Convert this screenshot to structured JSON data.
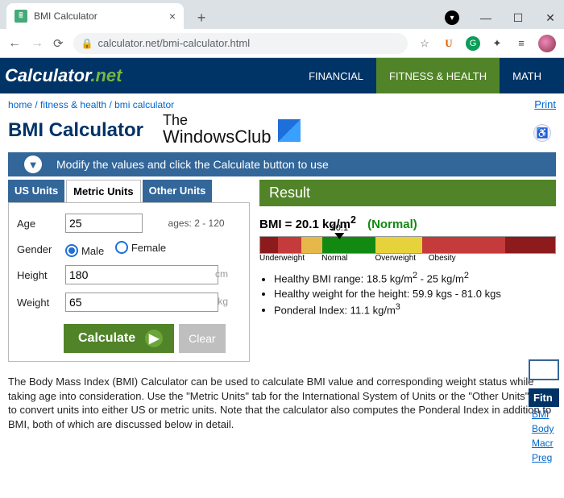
{
  "browser": {
    "tab_title": "BMI Calculator",
    "url_display": "calculator.net/bmi-calculator.html"
  },
  "site": {
    "brand1": "Calculator",
    "brand2": ".net",
    "nav": {
      "financial": "FINANCIAL",
      "fitness": "FITNESS & HEALTH",
      "math": "MATH"
    }
  },
  "breadcrumb": {
    "home": "home",
    "sep": " / ",
    "lvl1": "fitness & health",
    "lvl2": "bmi calculator"
  },
  "print": "Print",
  "page_title": "BMI Calculator",
  "overlay": {
    "line1": "The",
    "line2": "WindowsClub"
  },
  "modify_bar": "Modify the values and click the Calculate button to use",
  "unit_tabs": {
    "us": "US Units",
    "metric": "Metric Units",
    "other": "Other Units"
  },
  "form": {
    "age_label": "Age",
    "age_value": "25",
    "age_hint": "ages: 2 - 120",
    "gender_label": "Gender",
    "male": "Male",
    "female": "Female",
    "height_label": "Height",
    "height_value": "180",
    "height_unit": "cm",
    "weight_label": "Weight",
    "weight_value": "65",
    "weight_unit": "kg",
    "calculate": "Calculate",
    "clear": "Clear"
  },
  "result": {
    "heading": "Result",
    "bmi_prefix": "BMI = ",
    "bmi_value": "20.1 kg/m",
    "bmi_exp": "2",
    "category": "(Normal)",
    "pointer": "20.1",
    "labels": {
      "uw": "Underweight",
      "nm": "Normal",
      "ow": "Overweight",
      "ob": "Obesity"
    },
    "bullets": {
      "b1a": "Healthy BMI range: 18.5 kg/m",
      "b1exp": "2",
      "b1b": " - 25 kg/m",
      "b1exp2": "2",
      "b2": "Healthy weight for the height: 59.9 kgs - 81.0 kgs",
      "b3a": "Ponderal Index: 11.1 kg/m",
      "b3exp": "3"
    }
  },
  "description": "The Body Mass Index (BMI) Calculator can be used to calculate BMI value and corresponding weight status while taking age into consideration. Use the \"Metric Units\" tab for the International System of Units or the \"Other Units\" tab to convert units into either US or metric units. Note that the calculator also computes the Ponderal Index in addition to BMI, both of which are discussed below in detail.",
  "rail": {
    "head": "Fitn",
    "l1": "BMI",
    "l2": "Body",
    "l3": "Macr",
    "l4": "Preg"
  },
  "colors": {
    "seg_uw_dark": "#b01e1e",
    "seg_uw": "#d84d4d",
    "seg_uw_lt": "#e6b84a",
    "seg_nm": "#128a12",
    "seg_ow": "#e6d23a",
    "seg_ob": "#c53a3a",
    "seg_ob_dk": "#8e1b1b"
  }
}
